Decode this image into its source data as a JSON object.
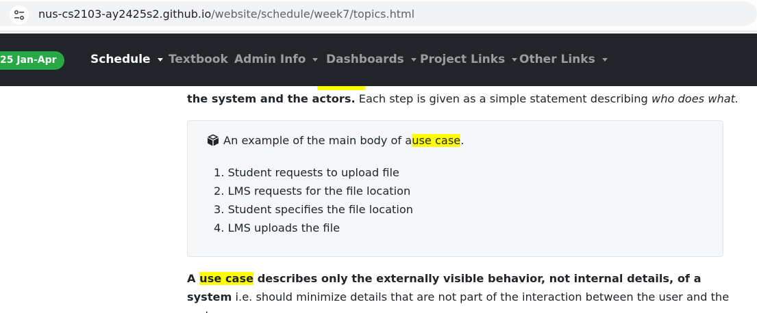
{
  "browser": {
    "url_domain": "nus-cs2103-ay2425s2.github.io",
    "url_path": "/website/schedule/week7/topics.html",
    "site_icon": "tune-icon"
  },
  "navbar": {
    "badge": "25 Jan-Apr",
    "items": [
      {
        "label": "Schedule",
        "dropdown": true,
        "active": true
      },
      {
        "label": "Textbook",
        "dropdown": false,
        "active": false
      },
      {
        "label": "Admin Info",
        "dropdown": true,
        "active": false
      },
      {
        "label": "Dashboards",
        "dropdown": true,
        "active": false
      },
      {
        "label": "Project Links",
        "dropdown": true,
        "active": false
      },
      {
        "label": "Other Links",
        "dropdown": true,
        "active": false
      }
    ],
    "background": "#212529",
    "badge_color": "#28a745"
  },
  "content": {
    "para1": {
      "bold": "the system and the actors.",
      "text": " Each step is given as a simple statement describing ",
      "italic": "who does what."
    },
    "example": {
      "icon": "cube-icon",
      "prefix": "An example of the main body of a ",
      "highlight": "use case",
      "suffix": ".",
      "steps": [
        "1. Student requests to upload file",
        "2. LMS requests for the file location",
        "3. Student specifies the file location",
        "4. LMS uploads the file"
      ]
    },
    "para2": {
      "bold_a": "A ",
      "highlight": "use case",
      "bold_b": " describes only the externally visible behavior, not internal details, of a system",
      "text": " i.e. should minimize details that are not part of the interaction between the user and the system."
    },
    "highlight_color": "#ffff00"
  }
}
